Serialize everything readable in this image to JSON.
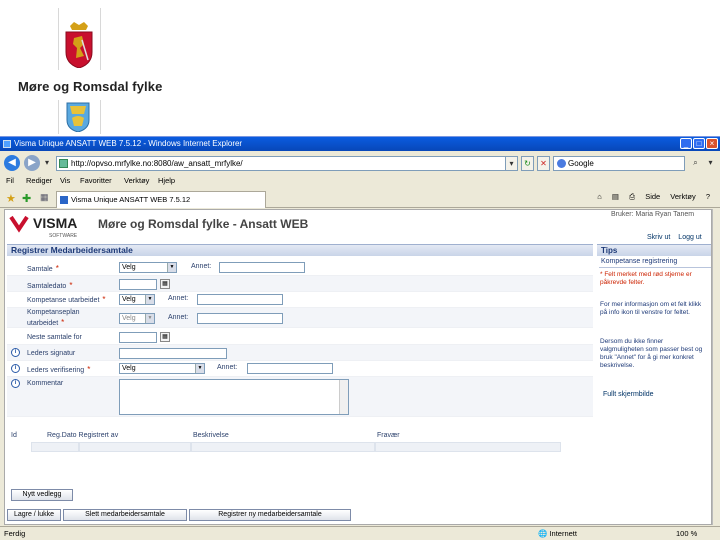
{
  "slide": {
    "org_name": "Møre og Romsdal fylke"
  },
  "browser": {
    "title": "Visma Unique ANSATT WEB 7.5.12 - Windows Internet Explorer",
    "url": "http://opvso.mrfylke.no:8080/aw_ansatt_mrfylke/",
    "search_text": "Google",
    "menu": [
      "Fil",
      "Rediger",
      "Vis",
      "Favoritter",
      "Verktøy",
      "Hjelp"
    ],
    "tab_title": "Visma Unique ANSATT WEB 7.5.12",
    "tools": [
      "Side",
      "Verktøy"
    ],
    "status_left": "Ferdig",
    "status_right": "Internett",
    "zoom": "100 %"
  },
  "app": {
    "logo": "VISMA",
    "logo_sub": "SOFTWARE",
    "title": "Møre og Romsdal fylke - Ansatt WEB",
    "user_label": "Bruker: Maria Ryan Tanem",
    "links": [
      "Skriv ut",
      "Logg ut"
    ],
    "form_title": "Registrer Medarbeidersamtale",
    "tips_title": "Tips",
    "tips_subtitle": "Kompetanse registrering",
    "tips_required": "* Felt merket med rød stjerne er påkrevde felter.",
    "tips_more": "For mer informasjon om et felt klikk på info ikon til venstre for feltet.",
    "tips_other": "Dersom du ikke finner valgmuligheten som passer best og bruk \"Annet\" for å gi mer konkret beskrivelse.",
    "tips_link": "Fullt skjermbilde"
  },
  "form": {
    "samtale": {
      "label": "Samtale",
      "value": "Velg",
      "annet": "Annet:"
    },
    "samtaledato": {
      "label": "Samtaledato"
    },
    "kompetanse_utarbeidet": {
      "label": "Kompetanse utarbeidet",
      "value": "Velg",
      "annet": "Annet:"
    },
    "kompetanseplan": {
      "label1": "Kompetanseplan",
      "label2": "utarbeidet",
      "value": "Velg",
      "annet": "Annet:"
    },
    "neste_samtale": {
      "label": "Neste samtale for"
    },
    "leders_signatur": {
      "label": "Leders signatur"
    },
    "leders_verifisering": {
      "label": "Leders verifisering",
      "value": "Velg",
      "annet": "Annet:"
    },
    "kommentar": {
      "label": "Kommentar"
    }
  },
  "table": {
    "columns": [
      "Id",
      "Reg.Dato Registrert av",
      "Beskrivelse",
      "Fravær"
    ]
  },
  "buttons": {
    "new": "Nytt vedlegg",
    "save_close": "Lagre / lukke",
    "delete": "Slett medarbeidersamtale",
    "register_new": "Registrer ny medarbeidersamtale"
  },
  "colors": {
    "accent": "#1e3a78",
    "required": "#cc2200",
    "visma_red": "#c8102e"
  }
}
